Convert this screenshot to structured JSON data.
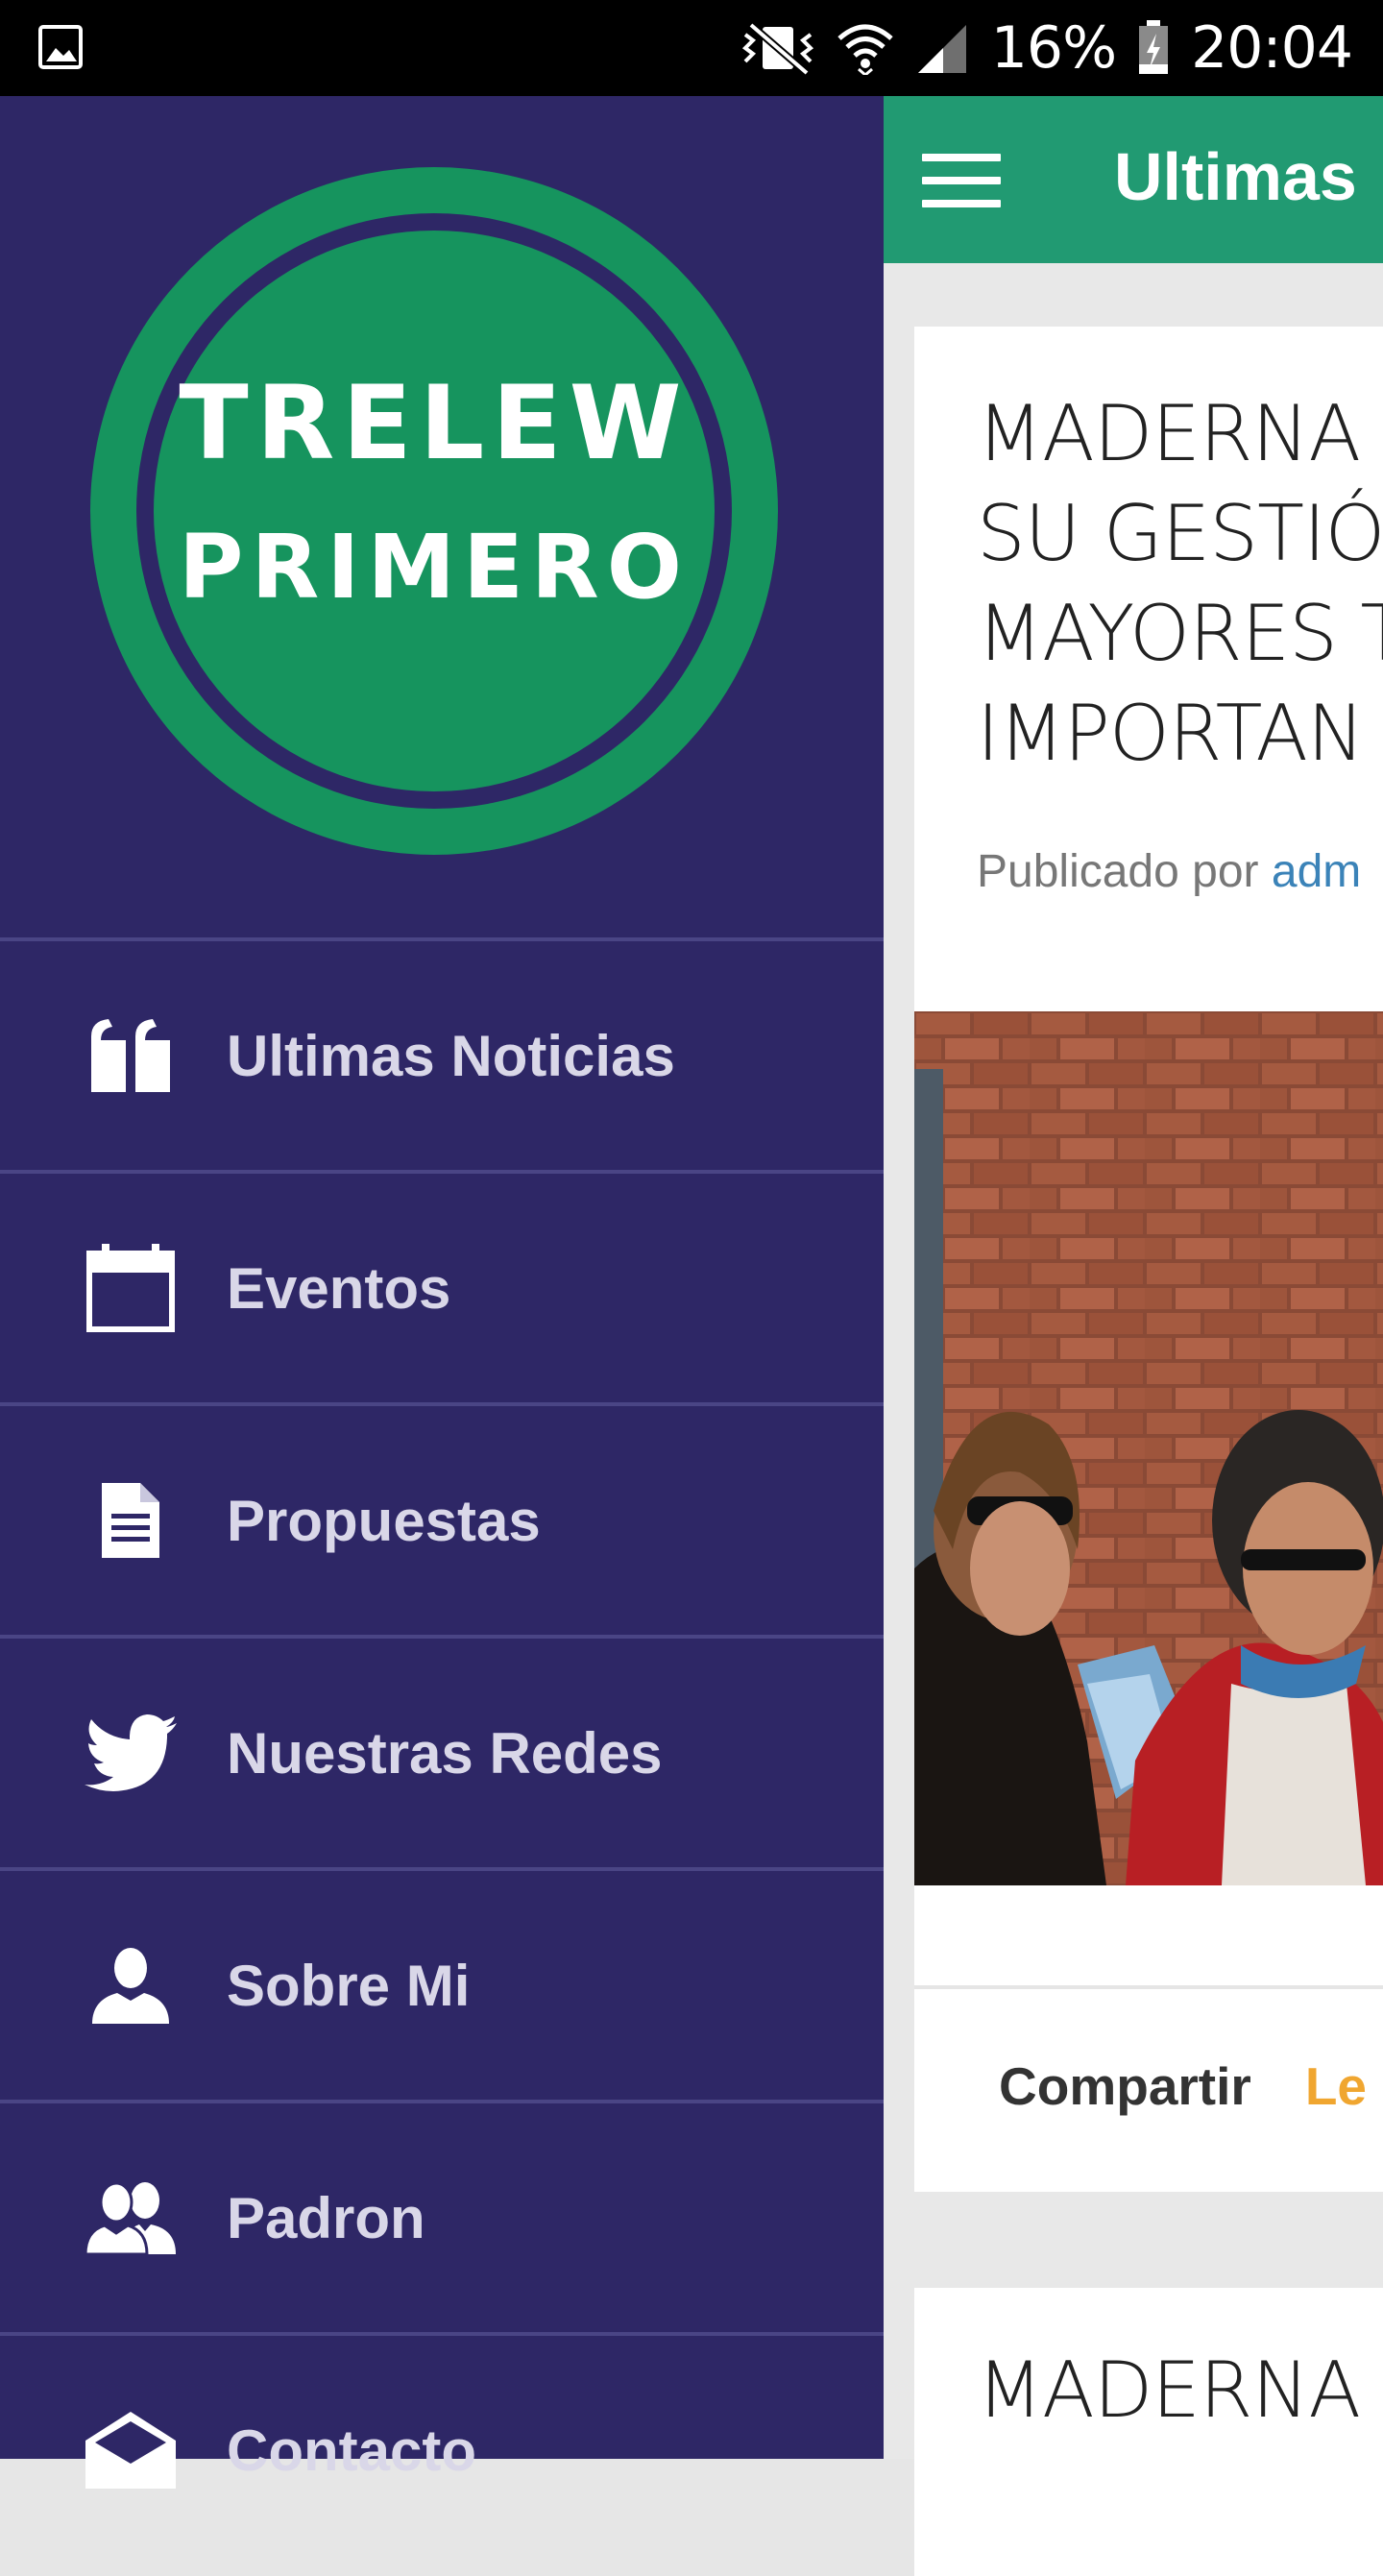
{
  "status_bar": {
    "battery": "16%",
    "time": "20:04",
    "icons": [
      "gallery-icon",
      "vibrate-icon",
      "wifi-icon",
      "signal-icon",
      "battery-icon"
    ]
  },
  "app_bar": {
    "title": "Ultimas",
    "menu_icon": "hamburger-icon",
    "color": "#219a72"
  },
  "drawer": {
    "logo": {
      "line1": "TRELEW",
      "line2": "PRIMERO"
    },
    "background": "#2e2766",
    "items": [
      {
        "label": "Ultimas Noticias",
        "icon": "quote-icon"
      },
      {
        "label": "Eventos",
        "icon": "calendar-icon"
      },
      {
        "label": "Propuestas",
        "icon": "document-icon"
      },
      {
        "label": "Nuestras Redes",
        "icon": "twitter-icon"
      },
      {
        "label": "Sobre Mi",
        "icon": "user-icon"
      },
      {
        "label": "Padron",
        "icon": "users-icon"
      },
      {
        "label": "Contacto",
        "icon": "envelope-open-icon"
      }
    ]
  },
  "posts": [
    {
      "title": "MADERNA\nSU GESTIÓ\nMAYORES T\nIMPORTAN",
      "byline_prefix": "Publicado por ",
      "byline_author": "adm",
      "share_label": "Compartir",
      "more_label": "Le"
    },
    {
      "title": "MADERNA"
    }
  ]
}
